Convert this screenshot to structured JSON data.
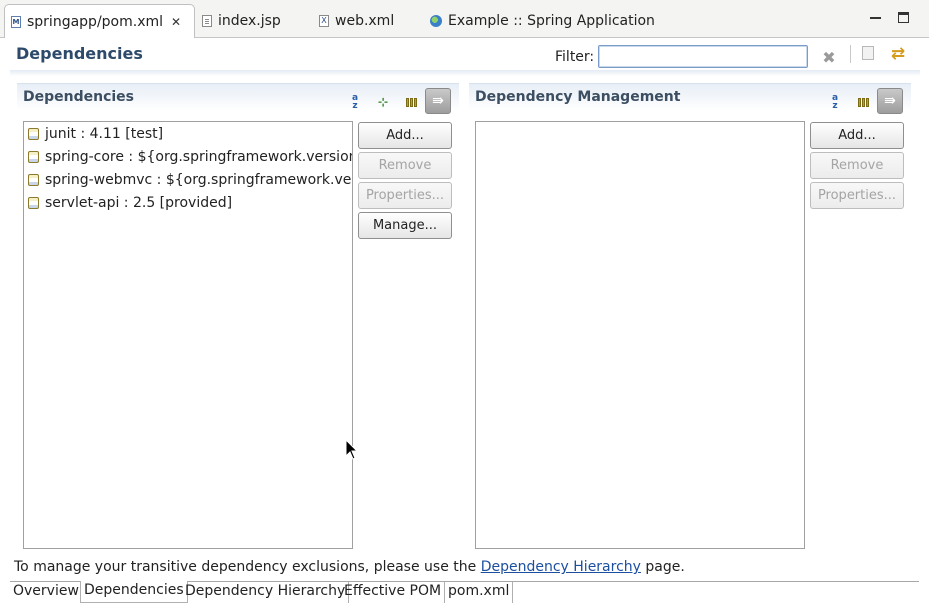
{
  "tabs": [
    {
      "label": "springapp/pom.xml",
      "icon": "maven-pom-icon",
      "active": true
    },
    {
      "label": "index.jsp",
      "icon": "jsp-file-icon"
    },
    {
      "label": "web.xml",
      "icon": "xml-file-icon"
    },
    {
      "label": "Example :: Spring Application",
      "icon": "globe-icon"
    }
  ],
  "header": {
    "title": "Dependencies",
    "filter_label": "Filter:",
    "filter_value": ""
  },
  "dependencies": {
    "title": "Dependencies",
    "items": [
      "junit : 4.11 [test]",
      "spring-core : ${org.springframework.version}",
      "spring-webmvc : ${org.springframework.version}",
      "servlet-api : 2.5 [provided]"
    ],
    "buttons": {
      "add": "Add...",
      "remove": "Remove",
      "properties": "Properties...",
      "manage": "Manage..."
    }
  },
  "dependency_management": {
    "title": "Dependency Management",
    "buttons": {
      "add": "Add...",
      "remove": "Remove",
      "properties": "Properties..."
    }
  },
  "footer": {
    "text_before": "To manage your transitive dependency exclusions, please use the ",
    "link": "Dependency Hierarchy",
    "text_after": " page."
  },
  "bottom_tabs": [
    "Overview",
    "Dependencies",
    "Dependency Hierarchy",
    "Effective POM",
    "pom.xml"
  ]
}
